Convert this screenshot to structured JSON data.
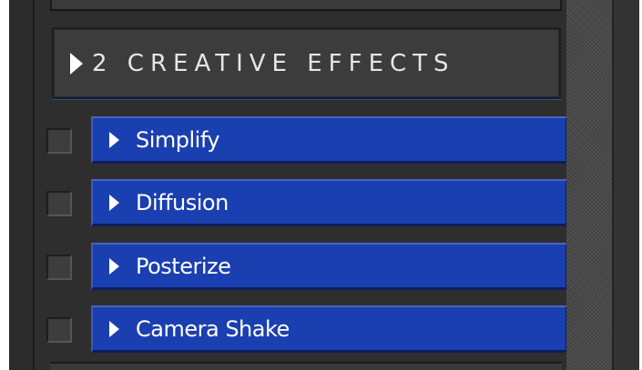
{
  "section": {
    "number_title": "2 CREATIVE EFFECTS"
  },
  "effects": [
    {
      "label": "Simplify",
      "checked": false
    },
    {
      "label": "Diffusion",
      "checked": false
    },
    {
      "label": "Posterize",
      "checked": false
    },
    {
      "label": "Camera Shake",
      "checked": false
    }
  ],
  "colors": {
    "effect_bar": "#1a3fb0",
    "panel_bg": "#2e2e2e",
    "header_bg": "#3c3c3c"
  },
  "icons": {
    "expand": "triangle-right-icon"
  }
}
